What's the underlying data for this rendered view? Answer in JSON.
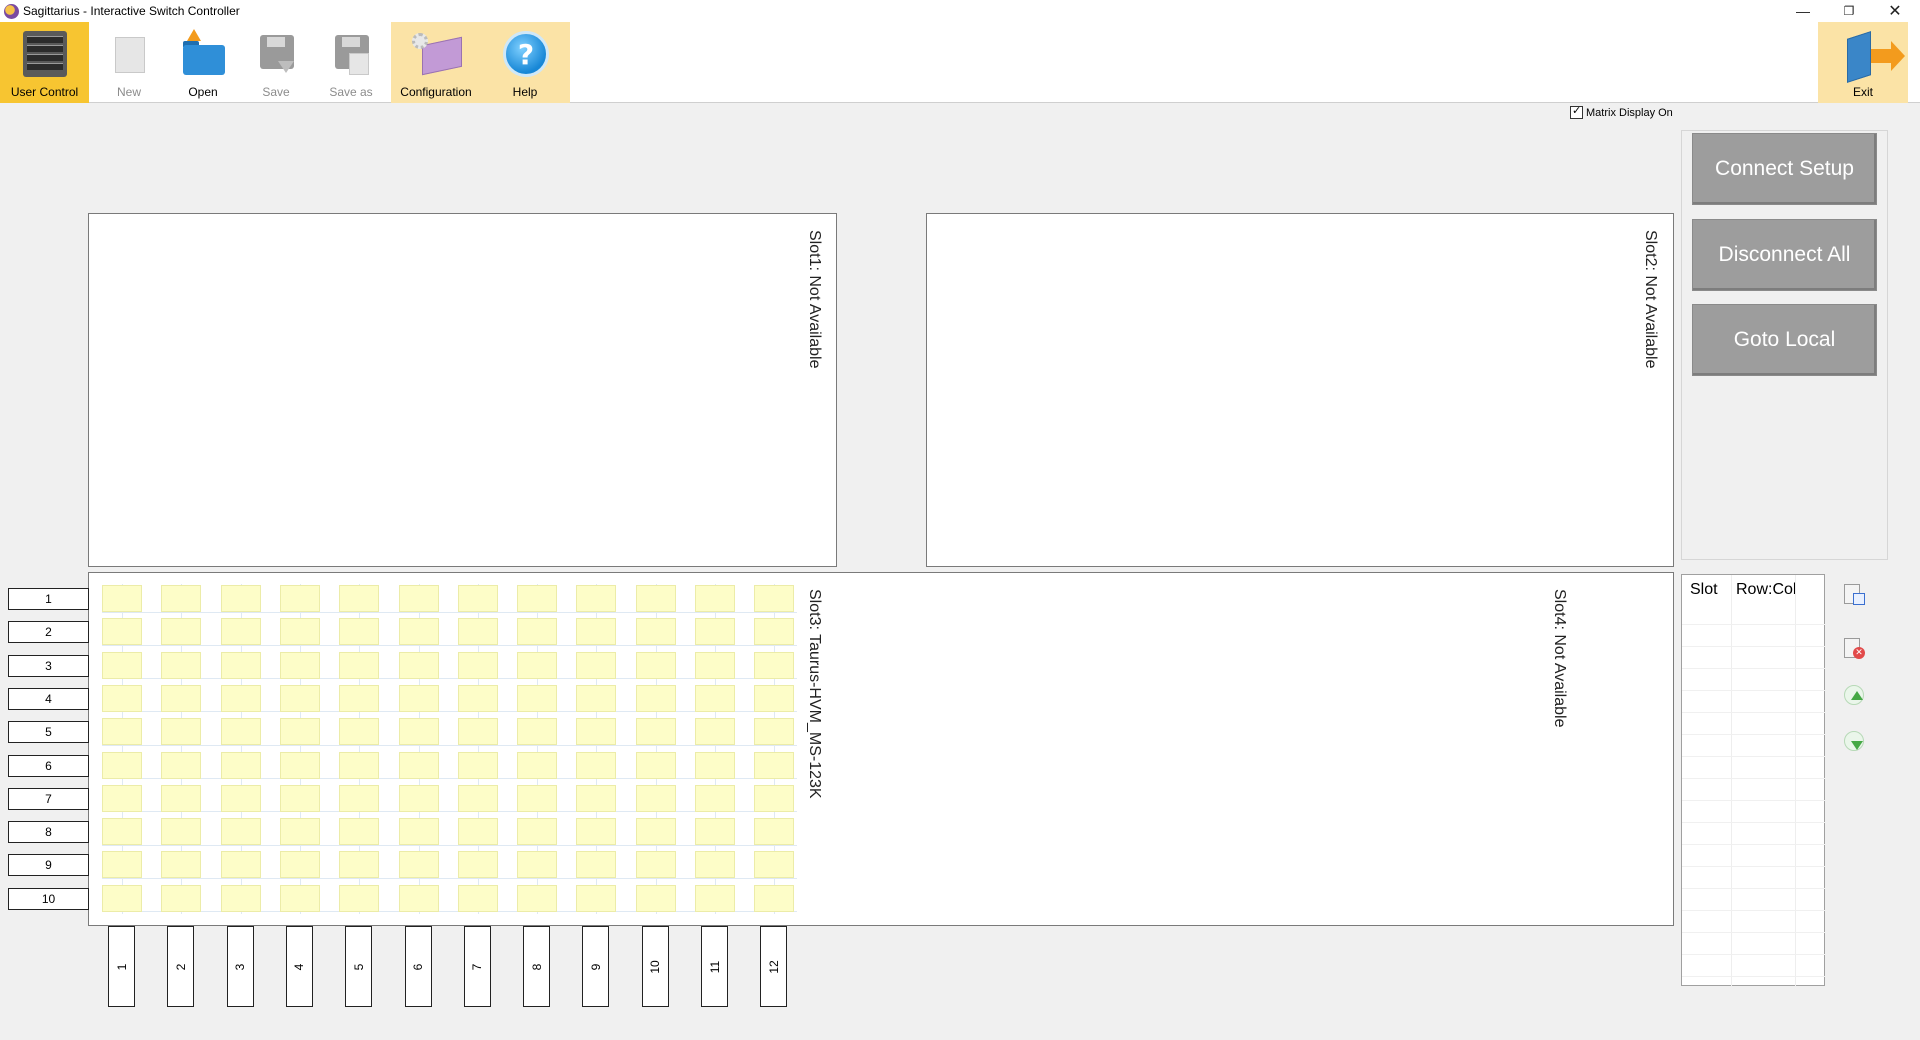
{
  "window": {
    "title": "Sagittarius - Interactive Switch Controller",
    "minimize": "—",
    "maximize": "❐",
    "close": "✕"
  },
  "toolbar": {
    "user_control": "User Control",
    "new": "New",
    "open": "Open",
    "save": "Save",
    "save_as": "Save as",
    "configuration": "Configuration",
    "help": "Help",
    "help_glyph": "?",
    "exit": "Exit"
  },
  "matrix_display": {
    "label": "Matrix Display On",
    "checked": true
  },
  "slots": {
    "slot1": "Slot1: Not Available",
    "slot2": "Slot2: Not Available",
    "slot3": "Slot3: Taurus-HVM_MS-123K",
    "slot4": "Slot4: Not Available"
  },
  "matrix": {
    "rows": [
      "1",
      "2",
      "3",
      "4",
      "5",
      "6",
      "7",
      "8",
      "9",
      "10"
    ],
    "columns": [
      "1",
      "2",
      "3",
      "4",
      "5",
      "6",
      "7",
      "8",
      "9",
      "10",
      "11",
      "12"
    ],
    "crosspoint_color": "#fdfdc8"
  },
  "actions": {
    "connect_setup": "Connect Setup",
    "disconnect_all": "Disconnect All",
    "goto_local": "Goto Local"
  },
  "connection_table": {
    "headers": [
      "Slot",
      "Row:Col"
    ],
    "rows": []
  },
  "colors": {
    "active_tab": "#f7c531",
    "highlight_tab": "#fbe3a6",
    "action_button": "#9d9d9d"
  }
}
